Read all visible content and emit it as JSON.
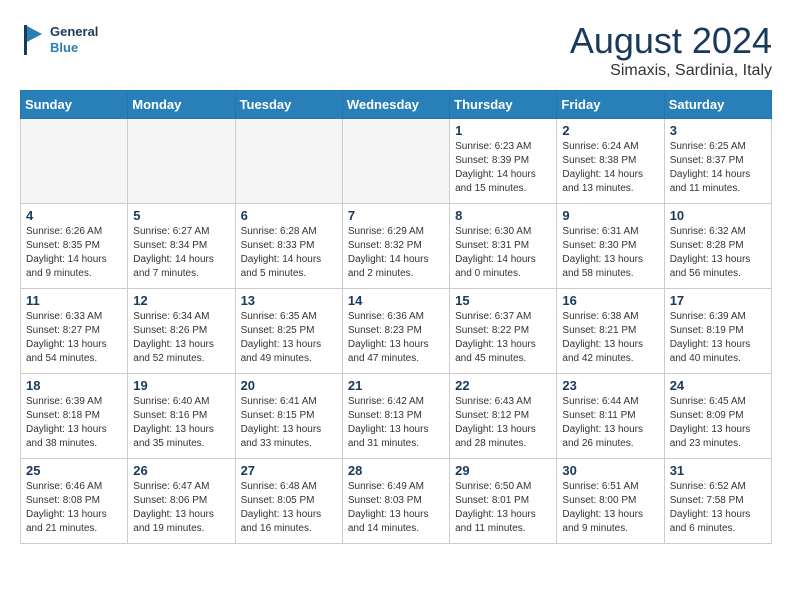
{
  "header": {
    "logo_line1": "General",
    "logo_line2": "Blue",
    "main_title": "August 2024",
    "subtitle": "Simaxis, Sardinia, Italy"
  },
  "days_of_week": [
    "Sunday",
    "Monday",
    "Tuesday",
    "Wednesday",
    "Thursday",
    "Friday",
    "Saturday"
  ],
  "weeks": [
    [
      {
        "day": "",
        "info": ""
      },
      {
        "day": "",
        "info": ""
      },
      {
        "day": "",
        "info": ""
      },
      {
        "day": "",
        "info": ""
      },
      {
        "day": "1",
        "info": "Sunrise: 6:23 AM\nSunset: 8:39 PM\nDaylight: 14 hours\nand 15 minutes."
      },
      {
        "day": "2",
        "info": "Sunrise: 6:24 AM\nSunset: 8:38 PM\nDaylight: 14 hours\nand 13 minutes."
      },
      {
        "day": "3",
        "info": "Sunrise: 6:25 AM\nSunset: 8:37 PM\nDaylight: 14 hours\nand 11 minutes."
      }
    ],
    [
      {
        "day": "4",
        "info": "Sunrise: 6:26 AM\nSunset: 8:35 PM\nDaylight: 14 hours\nand 9 minutes."
      },
      {
        "day": "5",
        "info": "Sunrise: 6:27 AM\nSunset: 8:34 PM\nDaylight: 14 hours\nand 7 minutes."
      },
      {
        "day": "6",
        "info": "Sunrise: 6:28 AM\nSunset: 8:33 PM\nDaylight: 14 hours\nand 5 minutes."
      },
      {
        "day": "7",
        "info": "Sunrise: 6:29 AM\nSunset: 8:32 PM\nDaylight: 14 hours\nand 2 minutes."
      },
      {
        "day": "8",
        "info": "Sunrise: 6:30 AM\nSunset: 8:31 PM\nDaylight: 14 hours\nand 0 minutes."
      },
      {
        "day": "9",
        "info": "Sunrise: 6:31 AM\nSunset: 8:30 PM\nDaylight: 13 hours\nand 58 minutes."
      },
      {
        "day": "10",
        "info": "Sunrise: 6:32 AM\nSunset: 8:28 PM\nDaylight: 13 hours\nand 56 minutes."
      }
    ],
    [
      {
        "day": "11",
        "info": "Sunrise: 6:33 AM\nSunset: 8:27 PM\nDaylight: 13 hours\nand 54 minutes."
      },
      {
        "day": "12",
        "info": "Sunrise: 6:34 AM\nSunset: 8:26 PM\nDaylight: 13 hours\nand 52 minutes."
      },
      {
        "day": "13",
        "info": "Sunrise: 6:35 AM\nSunset: 8:25 PM\nDaylight: 13 hours\nand 49 minutes."
      },
      {
        "day": "14",
        "info": "Sunrise: 6:36 AM\nSunset: 8:23 PM\nDaylight: 13 hours\nand 47 minutes."
      },
      {
        "day": "15",
        "info": "Sunrise: 6:37 AM\nSunset: 8:22 PM\nDaylight: 13 hours\nand 45 minutes."
      },
      {
        "day": "16",
        "info": "Sunrise: 6:38 AM\nSunset: 8:21 PM\nDaylight: 13 hours\nand 42 minutes."
      },
      {
        "day": "17",
        "info": "Sunrise: 6:39 AM\nSunset: 8:19 PM\nDaylight: 13 hours\nand 40 minutes."
      }
    ],
    [
      {
        "day": "18",
        "info": "Sunrise: 6:39 AM\nSunset: 8:18 PM\nDaylight: 13 hours\nand 38 minutes."
      },
      {
        "day": "19",
        "info": "Sunrise: 6:40 AM\nSunset: 8:16 PM\nDaylight: 13 hours\nand 35 minutes."
      },
      {
        "day": "20",
        "info": "Sunrise: 6:41 AM\nSunset: 8:15 PM\nDaylight: 13 hours\nand 33 minutes."
      },
      {
        "day": "21",
        "info": "Sunrise: 6:42 AM\nSunset: 8:13 PM\nDaylight: 13 hours\nand 31 minutes."
      },
      {
        "day": "22",
        "info": "Sunrise: 6:43 AM\nSunset: 8:12 PM\nDaylight: 13 hours\nand 28 minutes."
      },
      {
        "day": "23",
        "info": "Sunrise: 6:44 AM\nSunset: 8:11 PM\nDaylight: 13 hours\nand 26 minutes."
      },
      {
        "day": "24",
        "info": "Sunrise: 6:45 AM\nSunset: 8:09 PM\nDaylight: 13 hours\nand 23 minutes."
      }
    ],
    [
      {
        "day": "25",
        "info": "Sunrise: 6:46 AM\nSunset: 8:08 PM\nDaylight: 13 hours\nand 21 minutes."
      },
      {
        "day": "26",
        "info": "Sunrise: 6:47 AM\nSunset: 8:06 PM\nDaylight: 13 hours\nand 19 minutes."
      },
      {
        "day": "27",
        "info": "Sunrise: 6:48 AM\nSunset: 8:05 PM\nDaylight: 13 hours\nand 16 minutes."
      },
      {
        "day": "28",
        "info": "Sunrise: 6:49 AM\nSunset: 8:03 PM\nDaylight: 13 hours\nand 14 minutes."
      },
      {
        "day": "29",
        "info": "Sunrise: 6:50 AM\nSunset: 8:01 PM\nDaylight: 13 hours\nand 11 minutes."
      },
      {
        "day": "30",
        "info": "Sunrise: 6:51 AM\nSunset: 8:00 PM\nDaylight: 13 hours\nand 9 minutes."
      },
      {
        "day": "31",
        "info": "Sunrise: 6:52 AM\nSunset: 7:58 PM\nDaylight: 13 hours\nand 6 minutes."
      }
    ]
  ]
}
